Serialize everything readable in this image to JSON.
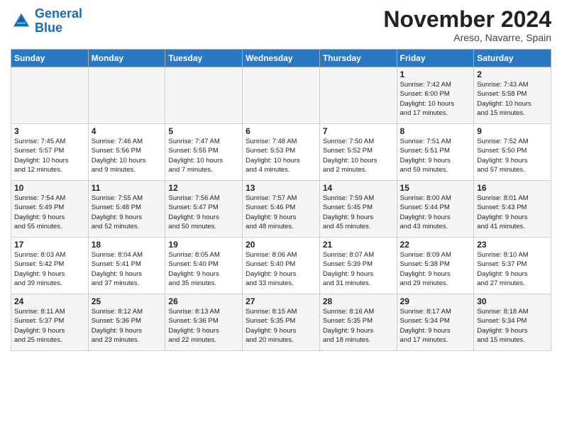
{
  "logo": {
    "line1": "General",
    "line2": "Blue"
  },
  "title": "November 2024",
  "location": "Areso, Navarre, Spain",
  "headers": [
    "Sunday",
    "Monday",
    "Tuesday",
    "Wednesday",
    "Thursday",
    "Friday",
    "Saturday"
  ],
  "weeks": [
    [
      {
        "day": "",
        "info": ""
      },
      {
        "day": "",
        "info": ""
      },
      {
        "day": "",
        "info": ""
      },
      {
        "day": "",
        "info": ""
      },
      {
        "day": "",
        "info": ""
      },
      {
        "day": "1",
        "info": "Sunrise: 7:42 AM\nSunset: 6:00 PM\nDaylight: 10 hours\nand 17 minutes."
      },
      {
        "day": "2",
        "info": "Sunrise: 7:43 AM\nSunset: 5:58 PM\nDaylight: 10 hours\nand 15 minutes."
      }
    ],
    [
      {
        "day": "3",
        "info": "Sunrise: 7:45 AM\nSunset: 5:57 PM\nDaylight: 10 hours\nand 12 minutes."
      },
      {
        "day": "4",
        "info": "Sunrise: 7:46 AM\nSunset: 5:56 PM\nDaylight: 10 hours\nand 9 minutes."
      },
      {
        "day": "5",
        "info": "Sunrise: 7:47 AM\nSunset: 5:55 PM\nDaylight: 10 hours\nand 7 minutes."
      },
      {
        "day": "6",
        "info": "Sunrise: 7:48 AM\nSunset: 5:53 PM\nDaylight: 10 hours\nand 4 minutes."
      },
      {
        "day": "7",
        "info": "Sunrise: 7:50 AM\nSunset: 5:52 PM\nDaylight: 10 hours\nand 2 minutes."
      },
      {
        "day": "8",
        "info": "Sunrise: 7:51 AM\nSunset: 5:51 PM\nDaylight: 9 hours\nand 59 minutes."
      },
      {
        "day": "9",
        "info": "Sunrise: 7:52 AM\nSunset: 5:50 PM\nDaylight: 9 hours\nand 57 minutes."
      }
    ],
    [
      {
        "day": "10",
        "info": "Sunrise: 7:54 AM\nSunset: 5:49 PM\nDaylight: 9 hours\nand 55 minutes."
      },
      {
        "day": "11",
        "info": "Sunrise: 7:55 AM\nSunset: 5:48 PM\nDaylight: 9 hours\nand 52 minutes."
      },
      {
        "day": "12",
        "info": "Sunrise: 7:56 AM\nSunset: 5:47 PM\nDaylight: 9 hours\nand 50 minutes."
      },
      {
        "day": "13",
        "info": "Sunrise: 7:57 AM\nSunset: 5:46 PM\nDaylight: 9 hours\nand 48 minutes."
      },
      {
        "day": "14",
        "info": "Sunrise: 7:59 AM\nSunset: 5:45 PM\nDaylight: 9 hours\nand 45 minutes."
      },
      {
        "day": "15",
        "info": "Sunrise: 8:00 AM\nSunset: 5:44 PM\nDaylight: 9 hours\nand 43 minutes."
      },
      {
        "day": "16",
        "info": "Sunrise: 8:01 AM\nSunset: 5:43 PM\nDaylight: 9 hours\nand 41 minutes."
      }
    ],
    [
      {
        "day": "17",
        "info": "Sunrise: 8:03 AM\nSunset: 5:42 PM\nDaylight: 9 hours\nand 39 minutes."
      },
      {
        "day": "18",
        "info": "Sunrise: 8:04 AM\nSunset: 5:41 PM\nDaylight: 9 hours\nand 37 minutes."
      },
      {
        "day": "19",
        "info": "Sunrise: 8:05 AM\nSunset: 5:40 PM\nDaylight: 9 hours\nand 35 minutes."
      },
      {
        "day": "20",
        "info": "Sunrise: 8:06 AM\nSunset: 5:40 PM\nDaylight: 9 hours\nand 33 minutes."
      },
      {
        "day": "21",
        "info": "Sunrise: 8:07 AM\nSunset: 5:39 PM\nDaylight: 9 hours\nand 31 minutes."
      },
      {
        "day": "22",
        "info": "Sunrise: 8:09 AM\nSunset: 5:38 PM\nDaylight: 9 hours\nand 29 minutes."
      },
      {
        "day": "23",
        "info": "Sunrise: 8:10 AM\nSunset: 5:37 PM\nDaylight: 9 hours\nand 27 minutes."
      }
    ],
    [
      {
        "day": "24",
        "info": "Sunrise: 8:11 AM\nSunset: 5:37 PM\nDaylight: 9 hours\nand 25 minutes."
      },
      {
        "day": "25",
        "info": "Sunrise: 8:12 AM\nSunset: 5:36 PM\nDaylight: 9 hours\nand 23 minutes."
      },
      {
        "day": "26",
        "info": "Sunrise: 8:13 AM\nSunset: 5:36 PM\nDaylight: 9 hours\nand 22 minutes."
      },
      {
        "day": "27",
        "info": "Sunrise: 8:15 AM\nSunset: 5:35 PM\nDaylight: 9 hours\nand 20 minutes."
      },
      {
        "day": "28",
        "info": "Sunrise: 8:16 AM\nSunset: 5:35 PM\nDaylight: 9 hours\nand 18 minutes."
      },
      {
        "day": "29",
        "info": "Sunrise: 8:17 AM\nSunset: 5:34 PM\nDaylight: 9 hours\nand 17 minutes."
      },
      {
        "day": "30",
        "info": "Sunrise: 8:18 AM\nSunset: 5:34 PM\nDaylight: 9 hours\nand 15 minutes."
      }
    ]
  ]
}
